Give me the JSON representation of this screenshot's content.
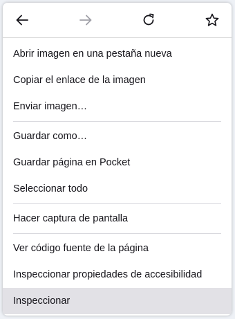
{
  "navbar": {
    "back_icon": "arrow-left-icon",
    "forward_icon": "arrow-right-icon",
    "reload_icon": "reload-icon",
    "bookmark_icon": "star-icon"
  },
  "menu": {
    "group1": [
      "Abrir imagen en una pestaña nueva",
      "Copiar el enlace de la imagen",
      "Enviar imagen…"
    ],
    "group2": [
      "Guardar como…",
      "Guardar página en Pocket",
      "Seleccionar todo"
    ],
    "group3": [
      "Hacer captura de pantalla"
    ],
    "group4": [
      "Ver código fuente de la página",
      "Inspeccionar propiedades de accesibilidad",
      "Inspeccionar"
    ]
  },
  "colors": {
    "menu_bg": "#ffffff",
    "hover_bg": "#e2e1e6",
    "text": "#15141a",
    "disabled_icon": "#a0a0a8"
  }
}
